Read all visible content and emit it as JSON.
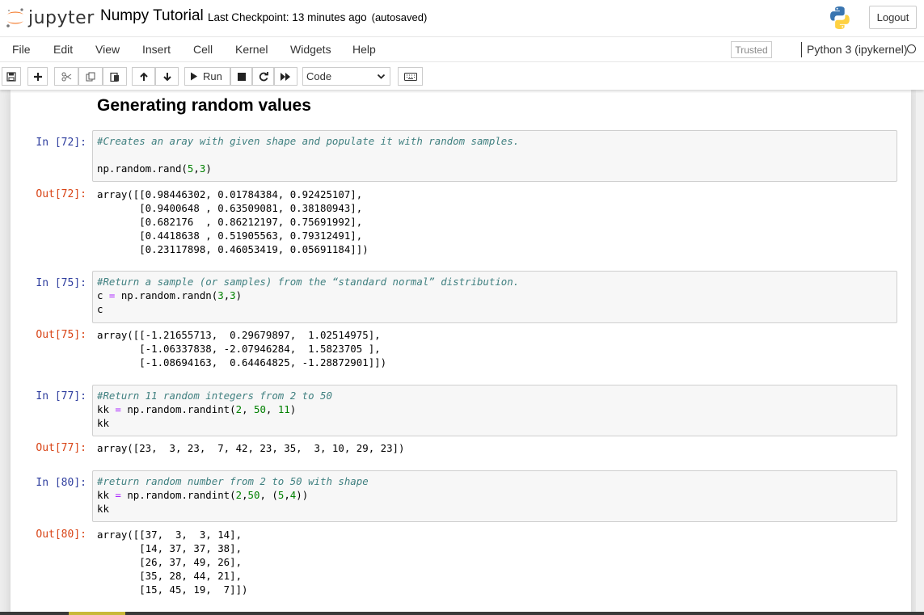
{
  "header": {
    "logo_text": "jupyter",
    "notebook_name": "Numpy Tutorial",
    "checkpoint": "Last Checkpoint: 13 minutes ago",
    "autosave": "(autosaved)",
    "logout_label": "Logout"
  },
  "menu": [
    "File",
    "Edit",
    "View",
    "Insert",
    "Cell",
    "Kernel",
    "Widgets",
    "Help"
  ],
  "trusted_label": "Trusted",
  "kernel_name": "Python 3 (ipykernel)",
  "toolbar": {
    "run_label": "Run",
    "cell_type": "Code"
  },
  "notebook": {
    "heading": "Generating random values",
    "cells": [
      {
        "in_prompt": "In [72]:",
        "comment": "#Creates an aray with given shape and populate it with random samples.",
        "code": [
          "",
          "np.random.rand(5,3)"
        ],
        "out_prompt": "Out[72]:",
        "output": [
          "array([[0.98446302, 0.01784384, 0.92425107],",
          "       [0.9400648 , 0.63509081, 0.38180943],",
          "       [0.682176  , 0.86212197, 0.75691992],",
          "       [0.4418638 , 0.51905563, 0.79312491],",
          "       [0.23117898, 0.46053419, 0.05691184]])"
        ]
      },
      {
        "in_prompt": "In [75]:",
        "comment": "#Return a sample (or samples) from the “standard normal” distribution.",
        "code": [
          "c = np.random.randn(3,3)",
          "c"
        ],
        "out_prompt": "Out[75]:",
        "output": [
          "array([[-1.21655713,  0.29679897,  1.02514975],",
          "       [-1.06337838, -2.07946284,  1.5823705 ],",
          "       [-1.08694163,  0.64464825, -1.28872901]])"
        ]
      },
      {
        "in_prompt": "In [77]:",
        "comment": "#Return 11 random integers from 2 to 50",
        "code": [
          "kk = np.random.randint(2, 50, 11)",
          "kk"
        ],
        "out_prompt": "Out[77]:",
        "output": [
          "array([23,  3, 23,  7, 42, 23, 35,  3, 10, 29, 23])"
        ]
      },
      {
        "in_prompt": "In [80]:",
        "comment": "#return random number from 2 to 50 with shape",
        "code": [
          "kk = np.random.randint(2,50, (5,4))",
          "kk"
        ],
        "out_prompt": "Out[80]:",
        "output": [
          "array([[37,  3,  3, 14],",
          "       [14, 37, 37, 38],",
          "       [26, 37, 49, 26],",
          "       [35, 28, 44, 21],",
          "       [15, 45, 19,  7]])"
        ]
      }
    ]
  },
  "colors": {
    "in_prompt": "#303f9f",
    "out_prompt": "#d84315",
    "comment": "#408080",
    "number": "#008000",
    "operator": "#aa22ff"
  }
}
